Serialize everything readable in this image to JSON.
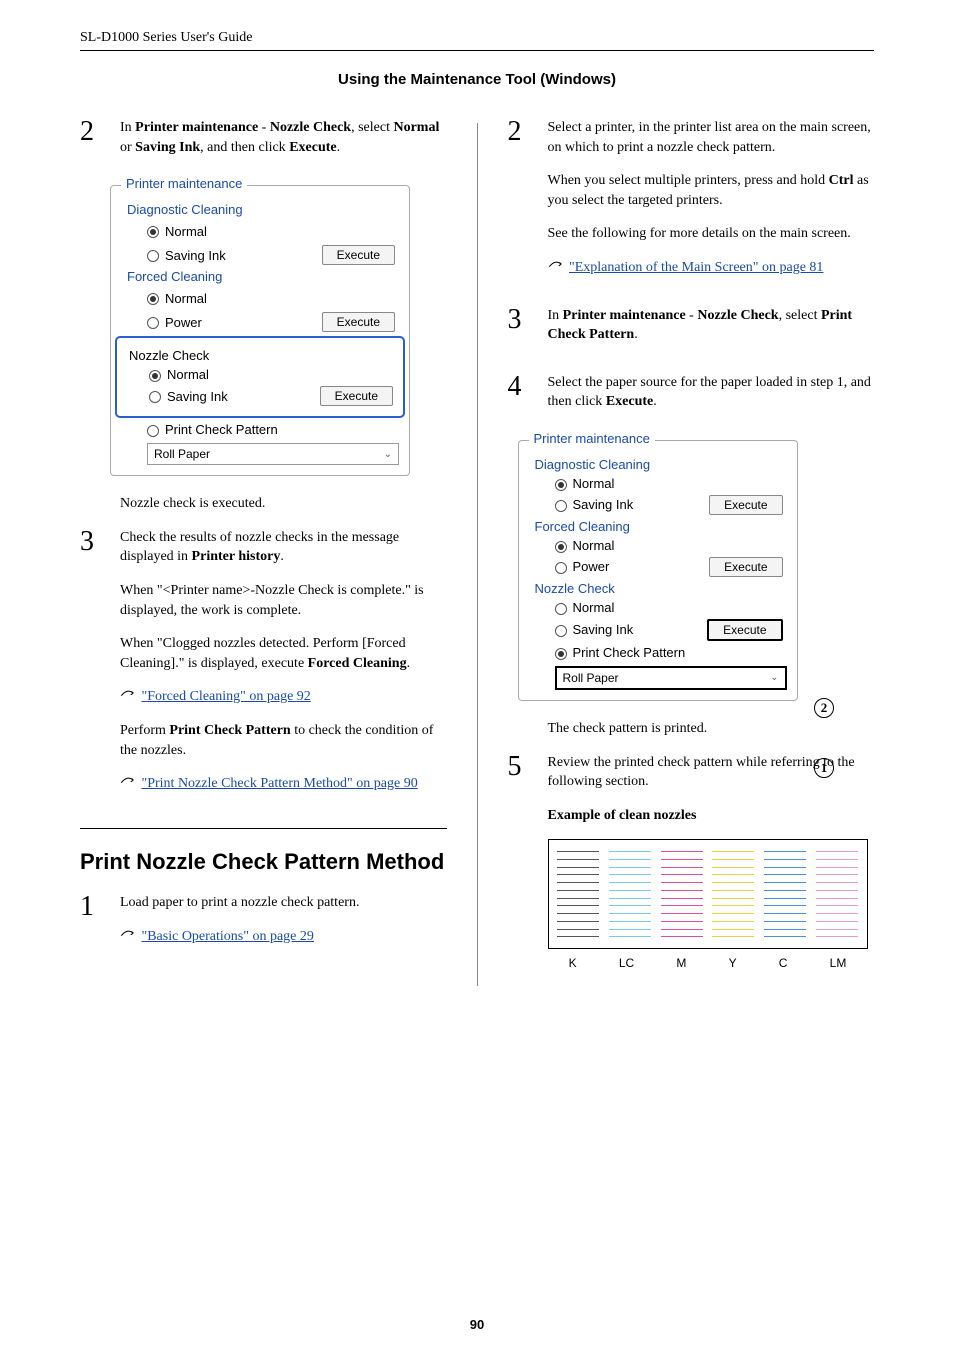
{
  "header": {
    "product": "SL-D1000 Series User's Guide",
    "section": "Using the Maintenance Tool (Windows)"
  },
  "page_number": "90",
  "left": {
    "step2_num": "2",
    "step2_a": "In ",
    "step2_b": "Printer maintenance",
    "step2_c": " - ",
    "step2_d": "Nozzle Check",
    "step2_e": ", select ",
    "step2_f": "Normal",
    "step2_g": " or ",
    "step2_h": "Saving Ink",
    "step2_i": ", and then click ",
    "step2_j": "Execute",
    "step2_k": ".",
    "p_after_panel": "Nozzle check is executed.",
    "step3_num": "3",
    "step3_a": "Check the results of nozzle checks in the message displayed in ",
    "step3_b": "Printer history",
    "step3_c": ".",
    "step3_p2": "When \"<Printer name>-Nozzle Check is complete.\" is displayed, the work is complete.",
    "step3_p3a": "When \"Clogged nozzles detected. Perform [Forced Cleaning].\" is displayed, execute ",
    "step3_p3b": "Forced Cleaning",
    "step3_p3c": ".",
    "link1": "\"Forced Cleaning\" on page 92",
    "step3_p4a": "Perform ",
    "step3_p4b": "Print Check Pattern",
    "step3_p4c": " to check the condition of the nozzles.",
    "link2": "\"Print Nozzle Check Pattern Method\" on page 90",
    "h2": "Print Nozzle Check Pattern Method",
    "step1_num": "1",
    "step1_text": "Load paper to print a nozzle check pattern.",
    "link3": "\"Basic Operations\" on page 29"
  },
  "right": {
    "step2_num": "2",
    "step2_text": "Select a printer, in the printer list area on the main screen, on which to print a nozzle check pattern.",
    "step2_p2a": "When you select multiple printers, press and hold ",
    "step2_p2b": "Ctrl",
    "step2_p2c": " as you select the targeted printers.",
    "step2_p3": "See the following for more details on the main screen.",
    "link4": "\"Explanation of the Main Screen\" on page 81",
    "step3_num": "3",
    "step3_a": "In ",
    "step3_b": "Printer maintenance",
    "step3_c": " - ",
    "step3_d": "Nozzle Check",
    "step3_e": ", select ",
    "step3_f": "Print Check Pattern",
    "step3_g": ".",
    "step4_num": "4",
    "step4_a": "Select the paper source for the paper loaded in step 1, and then click ",
    "step4_b": "Execute",
    "step4_c": ".",
    "p_after_panel2": "The check pattern is printed.",
    "step5_num": "5",
    "step5_text": "Review the printed check pattern while referring to the following section.",
    "example_heading": "Example of clean nozzles",
    "circ1": "1",
    "circ2": "2"
  },
  "panel": {
    "legend": "Printer maintenance",
    "diag": "Diagnostic Cleaning",
    "normal": "Normal",
    "saving": "Saving Ink",
    "execute": "Execute",
    "forced": "Forced Cleaning",
    "power": "Power",
    "nozzle": "Nozzle Check",
    "print_pattern": "Print Check Pattern",
    "roll": "Roll Paper"
  },
  "noz_labels": {
    "k": "K",
    "lc": "LC",
    "m": "M",
    "y": "Y",
    "c": "C",
    "lm": "LM"
  }
}
